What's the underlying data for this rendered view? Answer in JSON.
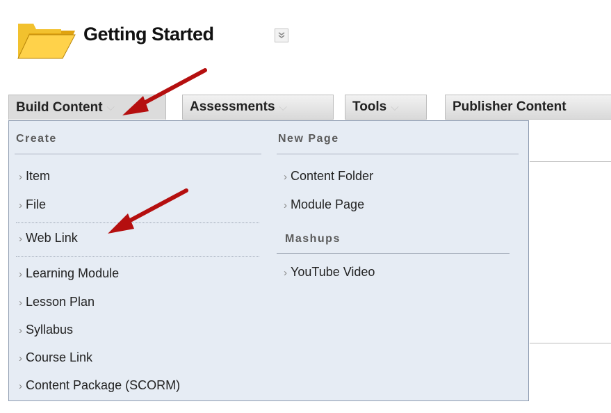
{
  "header": {
    "title": "Getting Started",
    "folder_icon": "folder-icon",
    "menu_icon": "chevron-down-icon"
  },
  "toolbar": {
    "build_content": "Build Content",
    "assessments": "Assessments",
    "tools": "Tools",
    "publisher_content": "Publisher Content"
  },
  "dropdown": {
    "create_heading": "Create",
    "create_items": [
      "Item",
      "File",
      "Web Link",
      "Learning Module",
      "Lesson Plan",
      "Syllabus",
      "Course Link",
      "Content Package (SCORM)"
    ],
    "new_page_heading": "New Page",
    "new_page_items": [
      "Content Folder",
      "Module Page"
    ],
    "mashups_heading": "Mashups",
    "mashups_items": [
      "YouTube Video"
    ]
  },
  "colors": {
    "dropdown_bg": "#e6ecf4",
    "arrow": "#b50f0f"
  }
}
